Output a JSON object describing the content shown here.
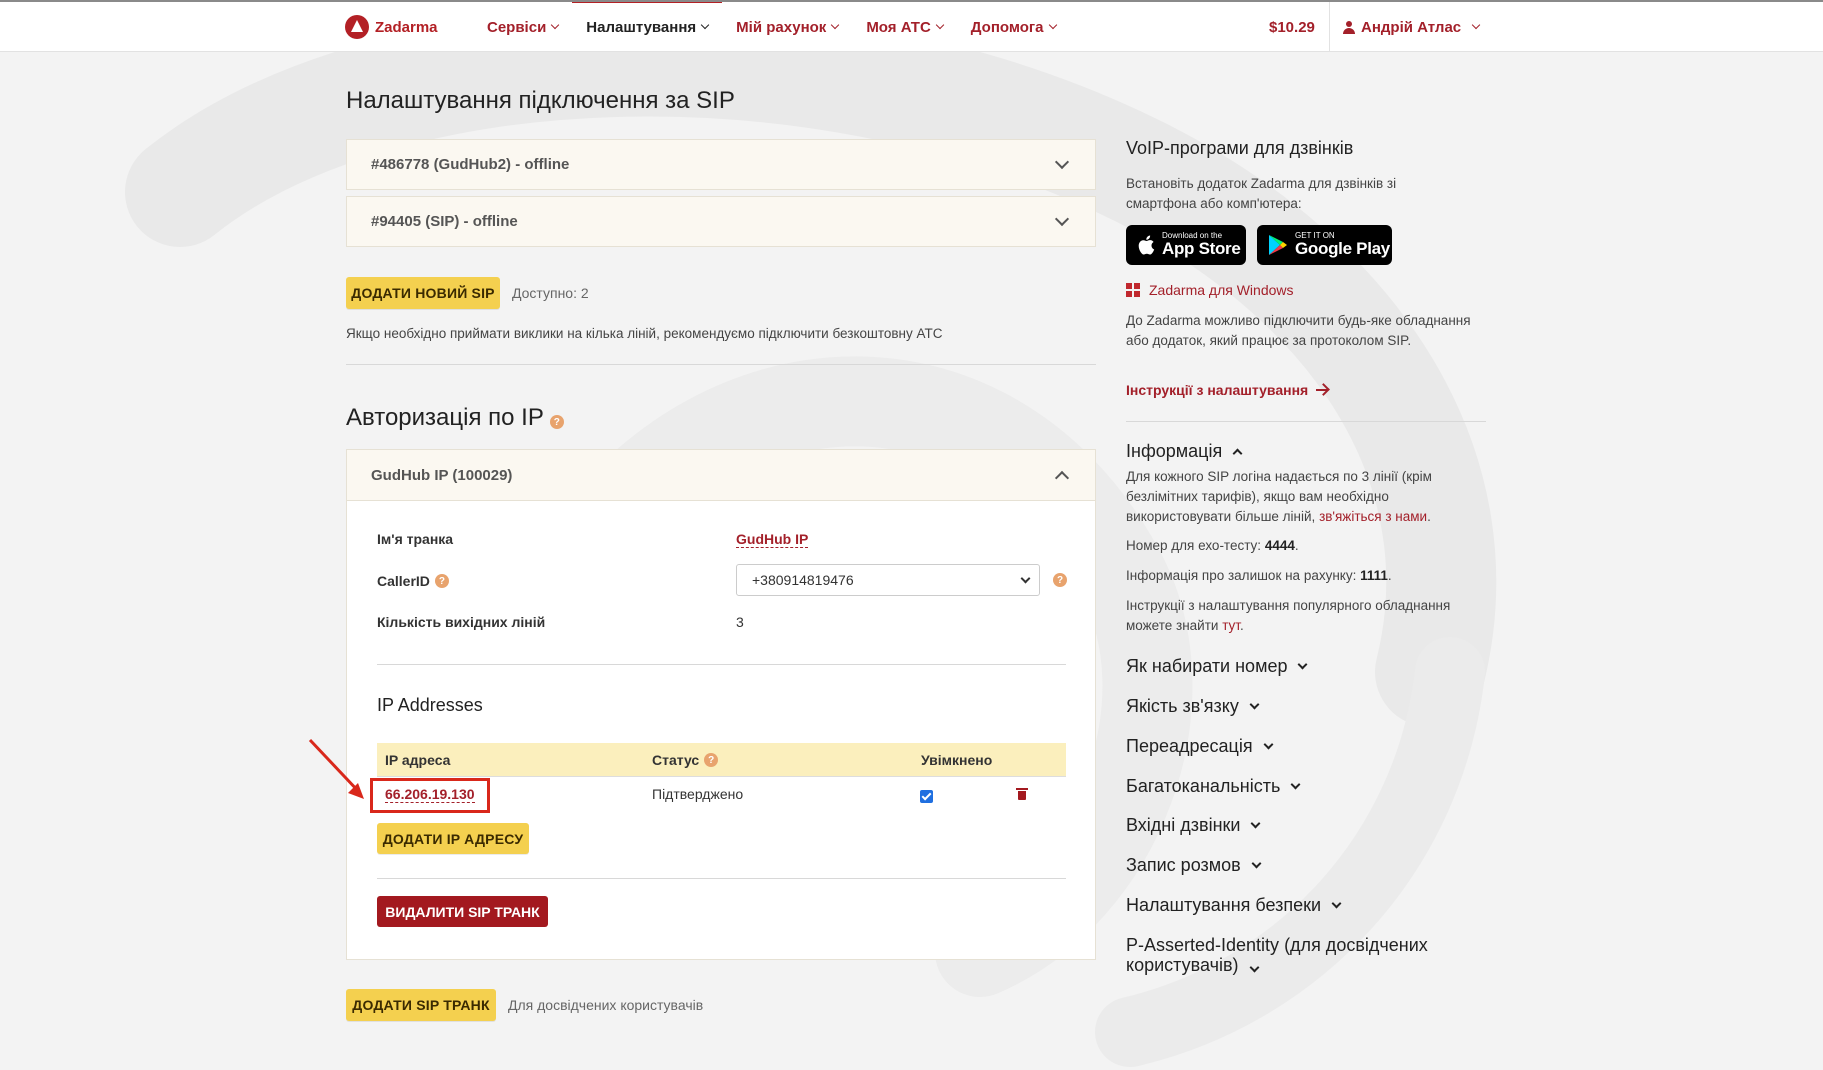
{
  "nav": {
    "logo": "Zadarma",
    "items": [
      {
        "label": "Сервіси",
        "active": false
      },
      {
        "label": "Налаштування",
        "active": true
      },
      {
        "label": "Мій рахунок",
        "active": false
      },
      {
        "label": "Моя АТС",
        "active": false
      },
      {
        "label": "Допомога",
        "active": false
      }
    ],
    "balance": "$10.29",
    "user": "Андрій Атлас"
  },
  "main": {
    "title": "Налаштування підключення за SIP",
    "sip_accounts": [
      "#486778 (GudHub2) - offline",
      "#94405 (SIP) - offline"
    ],
    "add_sip_label": "ДОДАТИ НОВИЙ SIP",
    "available": "Доступно: 2",
    "multi_line_note": "Якщо необхідно приймати виклики на кілька ліній, рекомендуємо підключити безкоштовну АТС",
    "ip_auth_title": "Авторизація по IP",
    "trunk": {
      "header": "GudHub IP (100029)",
      "name_label": "Ім'я транка",
      "name_value": "GudHub IP",
      "callerid_label": "CallerID",
      "callerid_value": "+380914819476",
      "lines_label": "Кількість вихідних ліній",
      "lines_value": "3",
      "ip_section_title": "IP Addresses",
      "columns": [
        "IP адреса",
        "Статус",
        "Увімкнено"
      ],
      "rows": [
        {
          "ip": "66.206.19.130",
          "status": "Підтверджено",
          "enabled": true
        }
      ],
      "add_ip_label": "ДОДАТИ IP АДРЕСУ",
      "delete_label": "ВИДАЛИТИ SIP ТРАНК"
    },
    "add_trunk_label": "ДОДАТИ SIP ТРАНК",
    "advanced_note": "Для досвідчених користувачів"
  },
  "sidebar": {
    "voip_title": "VoIP-програми для дзвінків",
    "voip_text": "Встановіть додаток Zadarma для дзвінків зі смартфона або комп'ютера:",
    "appstore_small": "Download on the",
    "appstore_big": "App Store",
    "googleplay_small": "GET IT ON",
    "googleplay_big": "Google Play",
    "windows_link": "Zadarma для Windows",
    "connect_text": "До Zadarma можливо підключити будь-яке обладнання або додаток, який працює за протоколом SIP.",
    "instructions_link": "Інструкції з налаштування",
    "info_title": "Інформація",
    "info_p1_a": "Для кожного SIP логіна надається по 3 лінії (крім безлімітних тарифів), якщо вам необхідно використовувати більше ліній, ",
    "info_p1_link": "зв'яжіться з нами",
    "info_p1_b": ".",
    "echo_label": "Номер для ехо-тесту: ",
    "echo_value": "4444",
    "echo_end": ".",
    "balance_label": "Інформація про залишок на рахунку: ",
    "balance_value": "1111",
    "balance_end": ".",
    "popular_text": "Інструкції з налаштування популярного обладнання можете знайти ",
    "popular_link": "тут",
    "popular_end": ".",
    "faq": [
      "Як набирати номер",
      "Якість зв'язку",
      "Переадресація",
      "Багатоканальність",
      "Вхідні дзвінки",
      "Запис розмов",
      "Налаштування безпеки",
      "P-Asserted-Identity (для досвідчених користувачів)"
    ]
  },
  "colors": {
    "brand": "#a3202a",
    "button_yellow": "#f4d04f",
    "button_red": "#a3191f",
    "highlight": "#d9281b"
  }
}
